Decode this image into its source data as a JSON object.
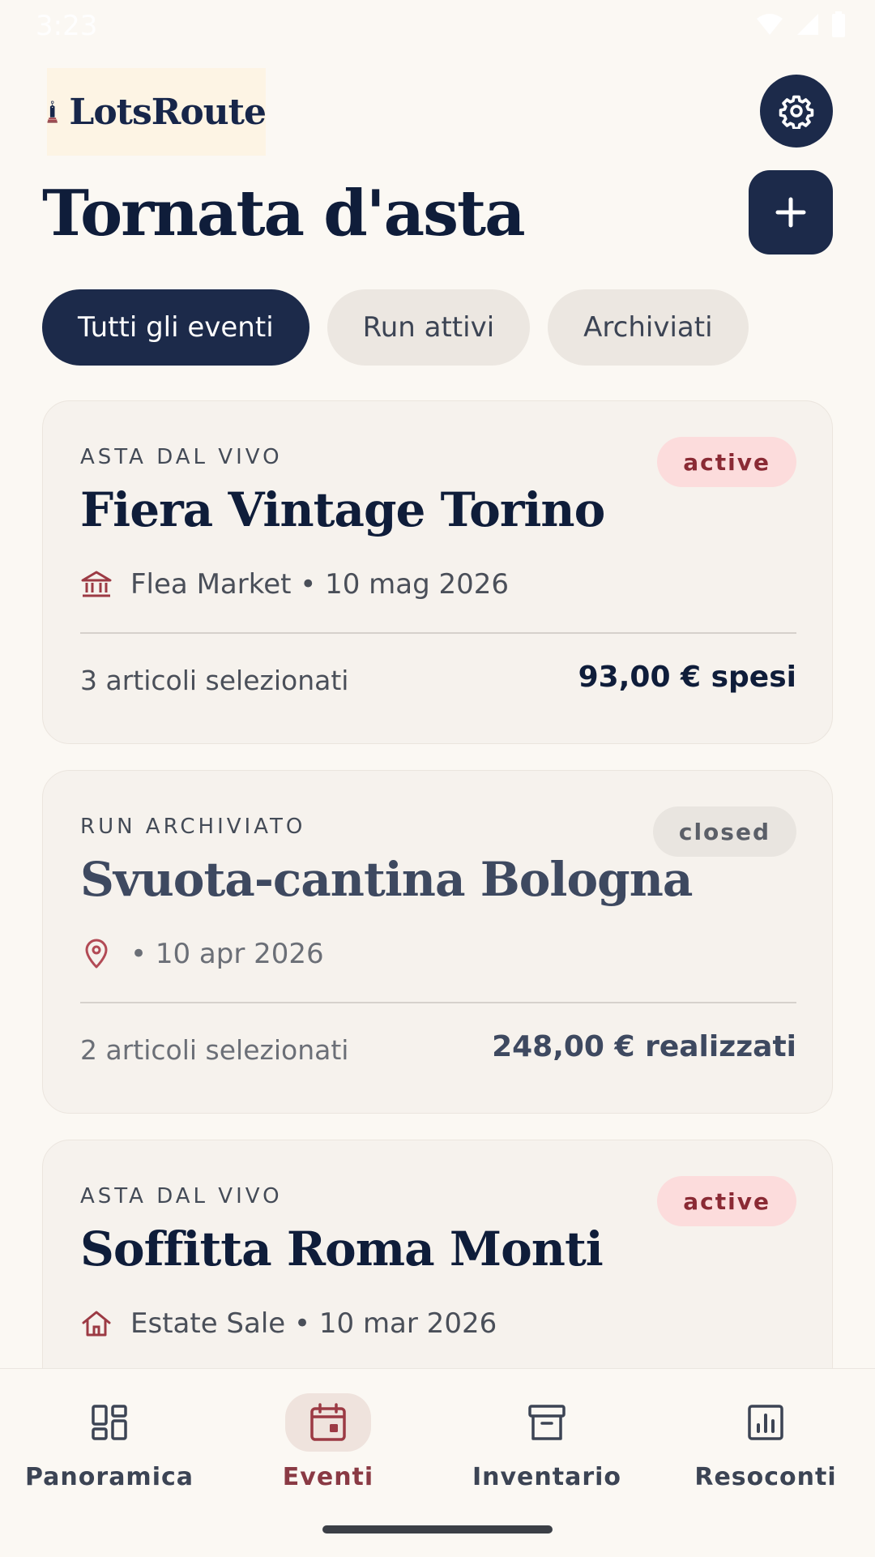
{
  "status_bar": {
    "time": "3:23"
  },
  "header": {
    "logo_text": "LotsRoute",
    "page_title": "Tornata d'asta"
  },
  "filters": [
    {
      "label": "Tutti gli eventi",
      "active": true
    },
    {
      "label": "Run attivi",
      "active": false
    },
    {
      "label": "Archiviati",
      "active": false
    }
  ],
  "events": [
    {
      "kicker": "ASTA DAL VIVO",
      "badge": "active",
      "title": "Fiera Vintage Torino",
      "venue_icon": "museum-icon",
      "meta": "Flea Market • 10 mag 2026",
      "count": "3 articoli selezionati",
      "amount": "93,00 € spesi"
    },
    {
      "kicker": "RUN ARCHIVIATO",
      "badge": "closed",
      "title": "Svuota-cantina Bologna",
      "venue_icon": "location-pin-icon",
      "meta": "• 10 apr 2026",
      "count": "2 articoli selezionati",
      "amount": "248,00 € realizzati"
    },
    {
      "kicker": "ASTA DAL VIVO",
      "badge": "active",
      "title": "Soffitta Roma Monti",
      "venue_icon": "house-icon",
      "meta": "Estate Sale • 10 mar 2026"
    }
  ],
  "bottom_nav": [
    {
      "label": "Panoramica",
      "icon": "dashboard-icon",
      "active": false
    },
    {
      "label": "Eventi",
      "icon": "calendar-icon",
      "active": true
    },
    {
      "label": "Inventario",
      "icon": "archive-box-icon",
      "active": false
    },
    {
      "label": "Resoconti",
      "icon": "bar-chart-icon",
      "active": false
    }
  ],
  "colors": {
    "primary": "#1c2a4a",
    "accent": "#8a3a44",
    "badge_active_bg": "#fcdcdc",
    "background": "#fbf8f3"
  }
}
